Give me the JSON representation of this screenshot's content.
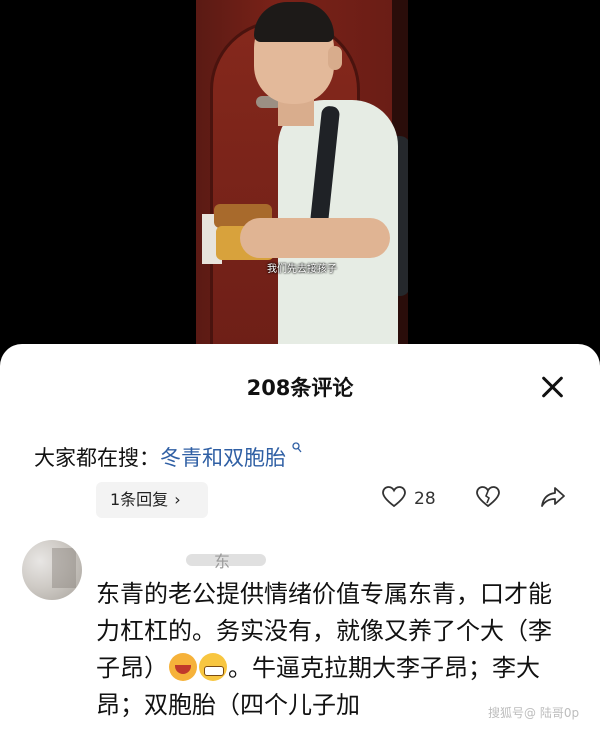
{
  "video": {
    "subtitle": "我们先去接孩子"
  },
  "comments_panel": {
    "title": "208条评论",
    "search_prefix": "大家都在搜：",
    "search_term": "冬青和双胞胎",
    "search_icon": "search-mini-icon",
    "reply_pill": {
      "label": "1条回复",
      "chevron": "›"
    },
    "like": {
      "icon": "heart-outline-icon",
      "count": "28"
    },
    "dislike": {
      "icon": "broken-heart-icon"
    },
    "share": {
      "icon": "share-arrow-icon"
    }
  },
  "comment": {
    "author": "东",
    "text_part1": "东青的老公提供情绪价值专属东青，口才能力杠杠的。务实没有，就像又养了个大（李子昂）",
    "text_part2": "。牛逼克拉期大李子昂；李大昂；双胞胎（四个儿子加",
    "emojis": [
      "laughing-face-emoji",
      "grinning-face-emoji"
    ]
  },
  "watermark": "搜狐号@ 陆哥0p"
}
